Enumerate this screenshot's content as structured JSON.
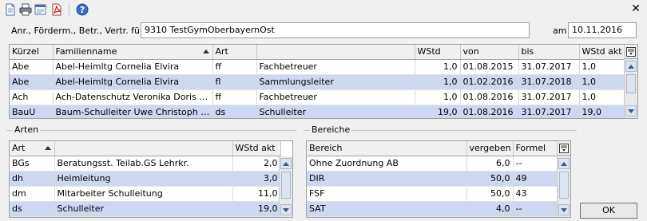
{
  "toolbar": {
    "close_symbol": "✕",
    "icons": [
      "new-document-icon",
      "print-icon",
      "print-preview-icon",
      "pdf-icon",
      "help-icon"
    ]
  },
  "header": {
    "label": "Anr., Förderm., Betr., Vertr. für",
    "school": "9310 TestGymOberbayernOst",
    "date_label": "am",
    "date": "10.11.2016"
  },
  "main_grid": {
    "columns": [
      "Kürzel",
      "Familienname",
      "Art",
      "",
      "WStd",
      "von",
      "bis",
      "WStd akt"
    ],
    "rows": [
      [
        "Abe",
        "Abel-Heimltg Cornelia Elvira",
        "ff",
        "Fachbetreuer",
        "1,0",
        "01.08.2015",
        "31.07.2017",
        "1,0"
      ],
      [
        "Abe",
        "Abel-Heimltg Cornelia Elvira",
        "fl",
        "Sammlungsleiter",
        "1,0",
        "01.02.2016",
        "31.07.2018",
        "1,0"
      ],
      [
        "Ach",
        "Ach-Datenschutz Veronika Doris Ra...",
        "ff",
        "Fachbetreuer",
        "1,0",
        "01.08.2016",
        "31.07.2017",
        "1,0"
      ],
      [
        "BauU",
        "Baum-Schulleiter Uwe Christoph Ek...",
        "ds",
        "Schulleiter",
        "19,0",
        "01.08.2016",
        "31.07.2017",
        "19,0"
      ]
    ]
  },
  "arten": {
    "group_label": "Arten",
    "columns": [
      "Art",
      "",
      "WStd akt"
    ],
    "rows": [
      [
        "BGs",
        "Beratungsst. Teilab.GS Lehrkr.",
        "2,0"
      ],
      [
        "dh",
        "Heimleitung",
        "3,0"
      ],
      [
        "dm",
        "Mitarbeiter Schulleitung",
        "11,0"
      ],
      [
        "ds",
        "Schulleiter",
        "19,0"
      ]
    ]
  },
  "bereiche": {
    "group_label": "Bereiche",
    "columns": [
      "Bereich",
      "vergeben",
      "Formel"
    ],
    "rows": [
      [
        "Ohne Zuordnung AB",
        "6,0",
        "--"
      ],
      [
        "DIR",
        "50,0",
        "49"
      ],
      [
        "FSF",
        "50,0",
        "43"
      ],
      [
        "SAT",
        "4,0",
        "--"
      ]
    ]
  },
  "ok_label": "OK"
}
